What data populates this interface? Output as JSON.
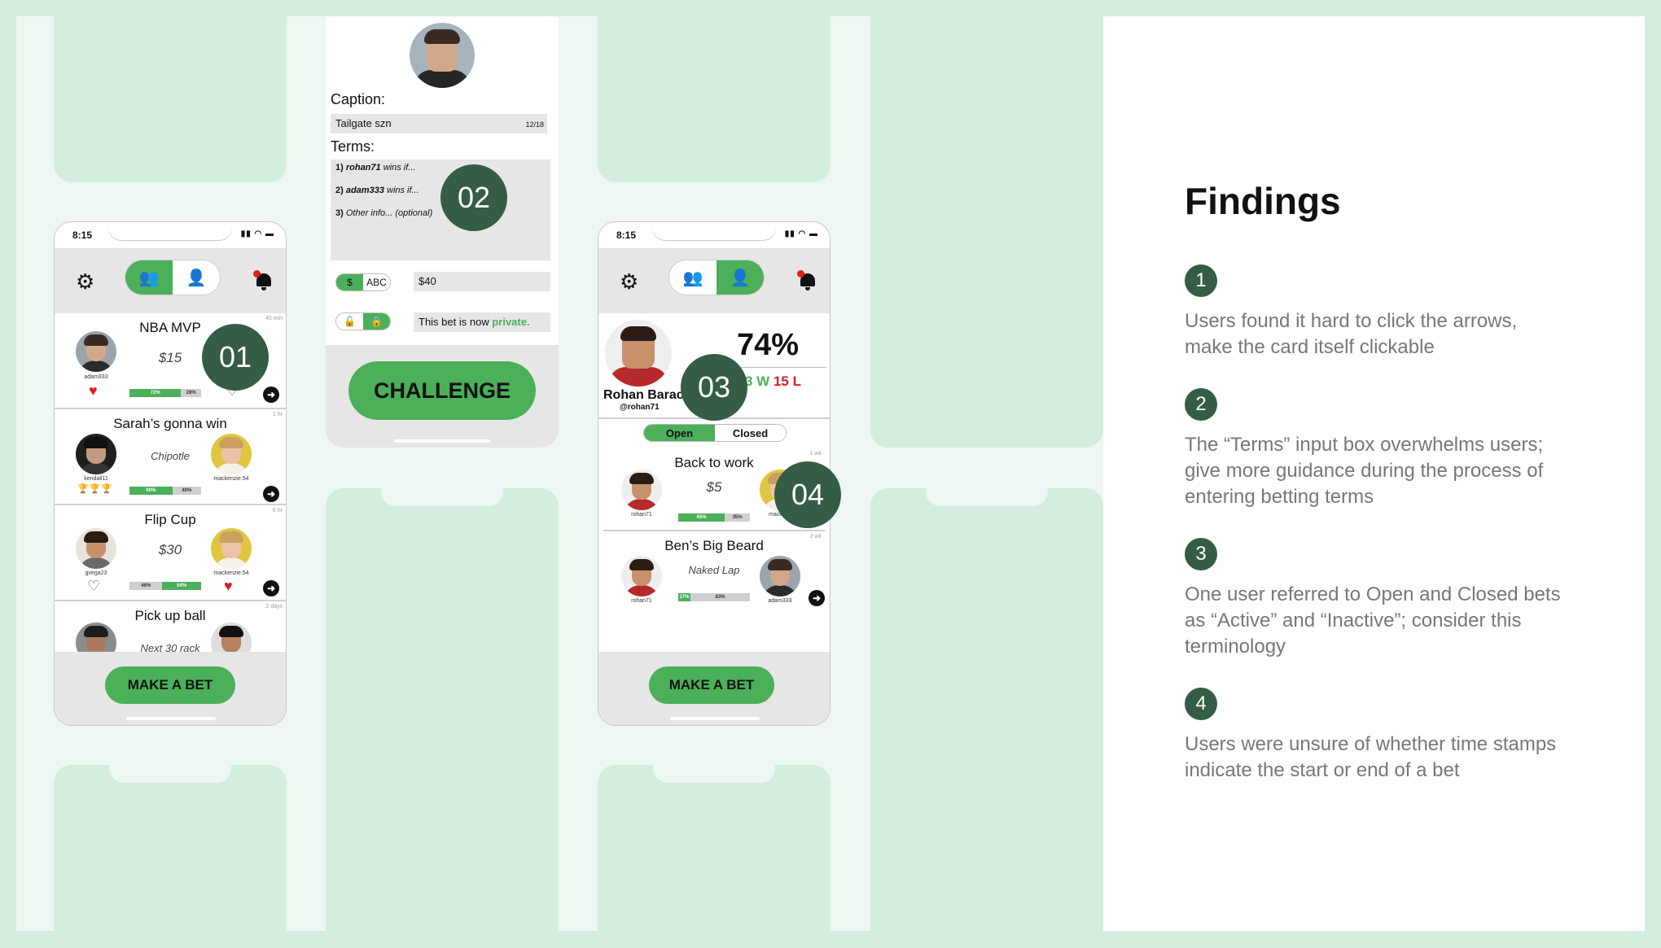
{
  "phone1": {
    "status_time": "8:15",
    "cards": [
      {
        "title": "NBA MVP",
        "amount": "$15",
        "stamp": "40 min",
        "left_user": "adam333",
        "right_user": "",
        "pct_a": "72%",
        "pct_b": "28%"
      },
      {
        "title": "Sarah’s gonna win",
        "amount": "Chipotle",
        "stamp": "1 hr",
        "left_user": "kendall11",
        "right_user": "mackenzie.54",
        "pct_a": "60%",
        "pct_b": "40%"
      },
      {
        "title": "Flip Cup",
        "amount": "$30",
        "stamp": "6 hr",
        "left_user": "gvega23",
        "right_user": "mackenzie.54",
        "pct_a": "46%",
        "pct_b": "54%"
      },
      {
        "title": "Pick up ball",
        "amount": "Next 30 rack",
        "stamp": "2 days"
      }
    ],
    "button": "MAKE A BET"
  },
  "phone2": {
    "caption_label": "Caption:",
    "caption_value": "Tailgate szn",
    "caption_count": "12/18",
    "terms_label": "Terms:",
    "terms": [
      {
        "num": "1)",
        "user": "rohan71",
        "rest": "wins if..."
      },
      {
        "num": "2)",
        "user": "adam333",
        "rest": "wins if..."
      },
      {
        "num": "3)",
        "user": "Other info... (optional)",
        "rest": ""
      }
    ],
    "currency_on": "$",
    "currency_off": "ABC",
    "amount_value": "$40",
    "privacy_text": "This bet is now ",
    "privacy_word": "private.",
    "button": "CHALLENGE"
  },
  "phone3": {
    "status_time": "8:15",
    "profile_name": "Rohan Barac",
    "profile_handle": "@rohan71",
    "win_pct": "74%",
    "wins": "3 W",
    "losses": "15 L",
    "tab_open": "Open",
    "tab_closed": "Closed",
    "cards": [
      {
        "title": "Back to work",
        "amount": "$5",
        "stamp": "1 wk",
        "left_user": "rohan71",
        "right_user": "mackenz",
        "pct_a": "65%",
        "pct_b": "35%"
      },
      {
        "title": "Ben’s Big Beard",
        "amount": "Naked Lap",
        "stamp": "2 wk",
        "left_user": "rohan71",
        "right_user": "adam333",
        "pct_a": "17%",
        "pct_b": "83%"
      }
    ],
    "button": "MAKE A BET"
  },
  "badges": [
    "01",
    "02",
    "03",
    "04"
  ],
  "findings": {
    "title": "Findings",
    "items": [
      {
        "num": "1",
        "text": "Users found it hard to click the arrows, make the card itself clickable"
      },
      {
        "num": "2",
        "text": "The “Terms” input box overwhelms users; give more guidance during the process of entering betting terms"
      },
      {
        "num": "3",
        "text": "One user referred to Open and Closed bets as “Active” and “Inactive”; consider this terminology"
      },
      {
        "num": "4",
        "text": "Users were unsure of whether time stamps indicate the start or end of a bet"
      }
    ]
  },
  "colors": {
    "accent": "#4caf5a",
    "badge": "#355c45",
    "background": "#d3eedd",
    "alert": "#e01e1e"
  }
}
